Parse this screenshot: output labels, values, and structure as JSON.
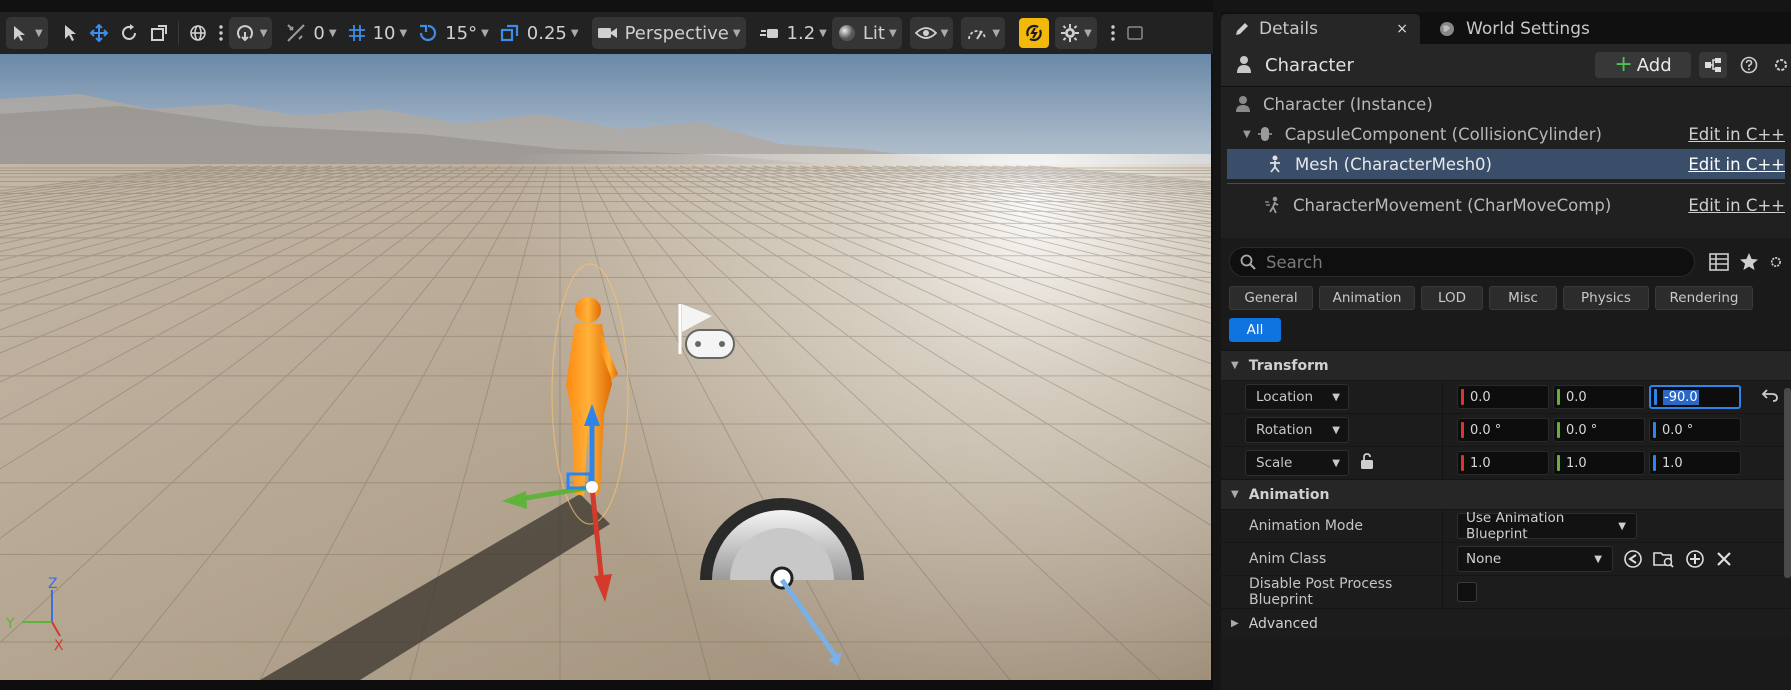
{
  "viewport_toolbar": {
    "translate_snap_value": "0",
    "grid_snap_value": "10",
    "rotation_snap_value": "15°",
    "scale_snap_value": "0.25",
    "view_mode_label": "Perspective",
    "camera_speed_value": "1.2",
    "lighting_mode_label": "Lit",
    "colors": {
      "toolbar_bg": "#222222",
      "snap_active": "#f2b80c",
      "accent_blue": "#3d8ce8"
    }
  },
  "viewport": {
    "axis_labels": {
      "z": "Z",
      "y": "Y",
      "x": "X"
    }
  },
  "tabs": [
    {
      "label": "Details",
      "close": "×"
    },
    {
      "label": "World Settings"
    }
  ],
  "panel_header": {
    "title": "Character",
    "add_label": "Add"
  },
  "components": [
    {
      "label": "Character (Instance)",
      "edit_link": ""
    },
    {
      "label": "CapsuleComponent (CollisionCylinder)",
      "edit_link": "Edit in C++"
    },
    {
      "label": "Mesh (CharacterMesh0)",
      "edit_link": "Edit in C++"
    },
    {
      "label": "CharacterMovement (CharMoveComp)",
      "edit_link": "Edit in C++"
    }
  ],
  "search": {
    "placeholder": "Search"
  },
  "filters": [
    "General",
    "Animation",
    "LOD",
    "Misc",
    "Physics",
    "Rendering",
    "All"
  ],
  "transform": {
    "header": "Transform",
    "location": {
      "label": "Location",
      "x": "0.0",
      "y": "0.0",
      "z": "-90.0"
    },
    "rotation": {
      "label": "Rotation",
      "x": "0.0 °",
      "y": "0.0 °",
      "z": "0.0 °"
    },
    "scale": {
      "label": "Scale",
      "x": "1.0",
      "y": "1.0",
      "z": "1.0"
    }
  },
  "animation": {
    "header": "Animation",
    "mode_label": "Animation Mode",
    "mode_value": "Use Animation Blueprint",
    "class_label": "Anim Class",
    "class_value": "None",
    "disable_pp_label": "Disable Post Process Blueprint"
  },
  "advanced": {
    "label": "Advanced"
  },
  "colors": {
    "selected_row": "#3a4e6a",
    "filter_active": "#0f73e0",
    "axis_x": "#d33a2c",
    "axis_y": "#5fb33a",
    "axis_z": "#2f84ea"
  }
}
